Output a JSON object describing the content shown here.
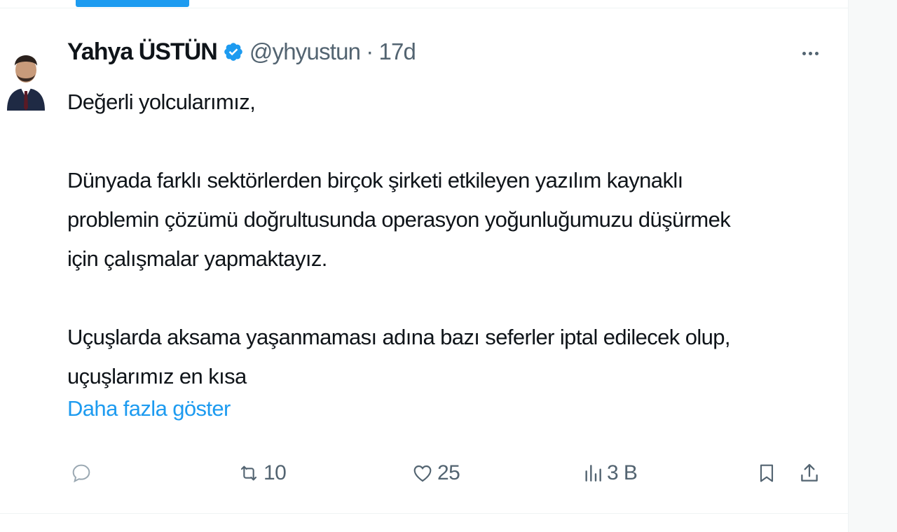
{
  "tweet": {
    "author_name": "Yahya ÜSTÜN",
    "handle": "@yhyustun",
    "separator": "·",
    "time": "17d",
    "text_lines": [
      "Değerli yolcularımız,",
      "",
      "Dünyada farklı sektörlerden birçok şirketi etkileyen yazılım kaynaklı",
      "problemin çözümü doğrultusunda operasyon yoğunluğumuzu düşürmek",
      "için çalışmalar yapmaktayız.",
      "",
      "Uçuşlarda aksama yaşanmaması adına bazı seferler iptal edilecek olup,",
      "uçuşlarımız en kısa"
    ],
    "show_more": "Daha fazla göster"
  },
  "actions": {
    "reply_count": "",
    "retweet_count": "10",
    "like_count": "25",
    "views_count": "3 B"
  },
  "icons": {
    "verified": "verified-badge-icon",
    "more": "more-dots-icon",
    "reply": "reply-icon",
    "retweet": "retweet-icon",
    "like": "heart-icon",
    "views": "views-bar-chart-icon",
    "bookmark": "bookmark-icon",
    "share": "share-icon"
  },
  "colors": {
    "accent": "#1d9bf0",
    "text": "#0f1419",
    "secondary": "#536471",
    "divider": "#eff3f4"
  }
}
